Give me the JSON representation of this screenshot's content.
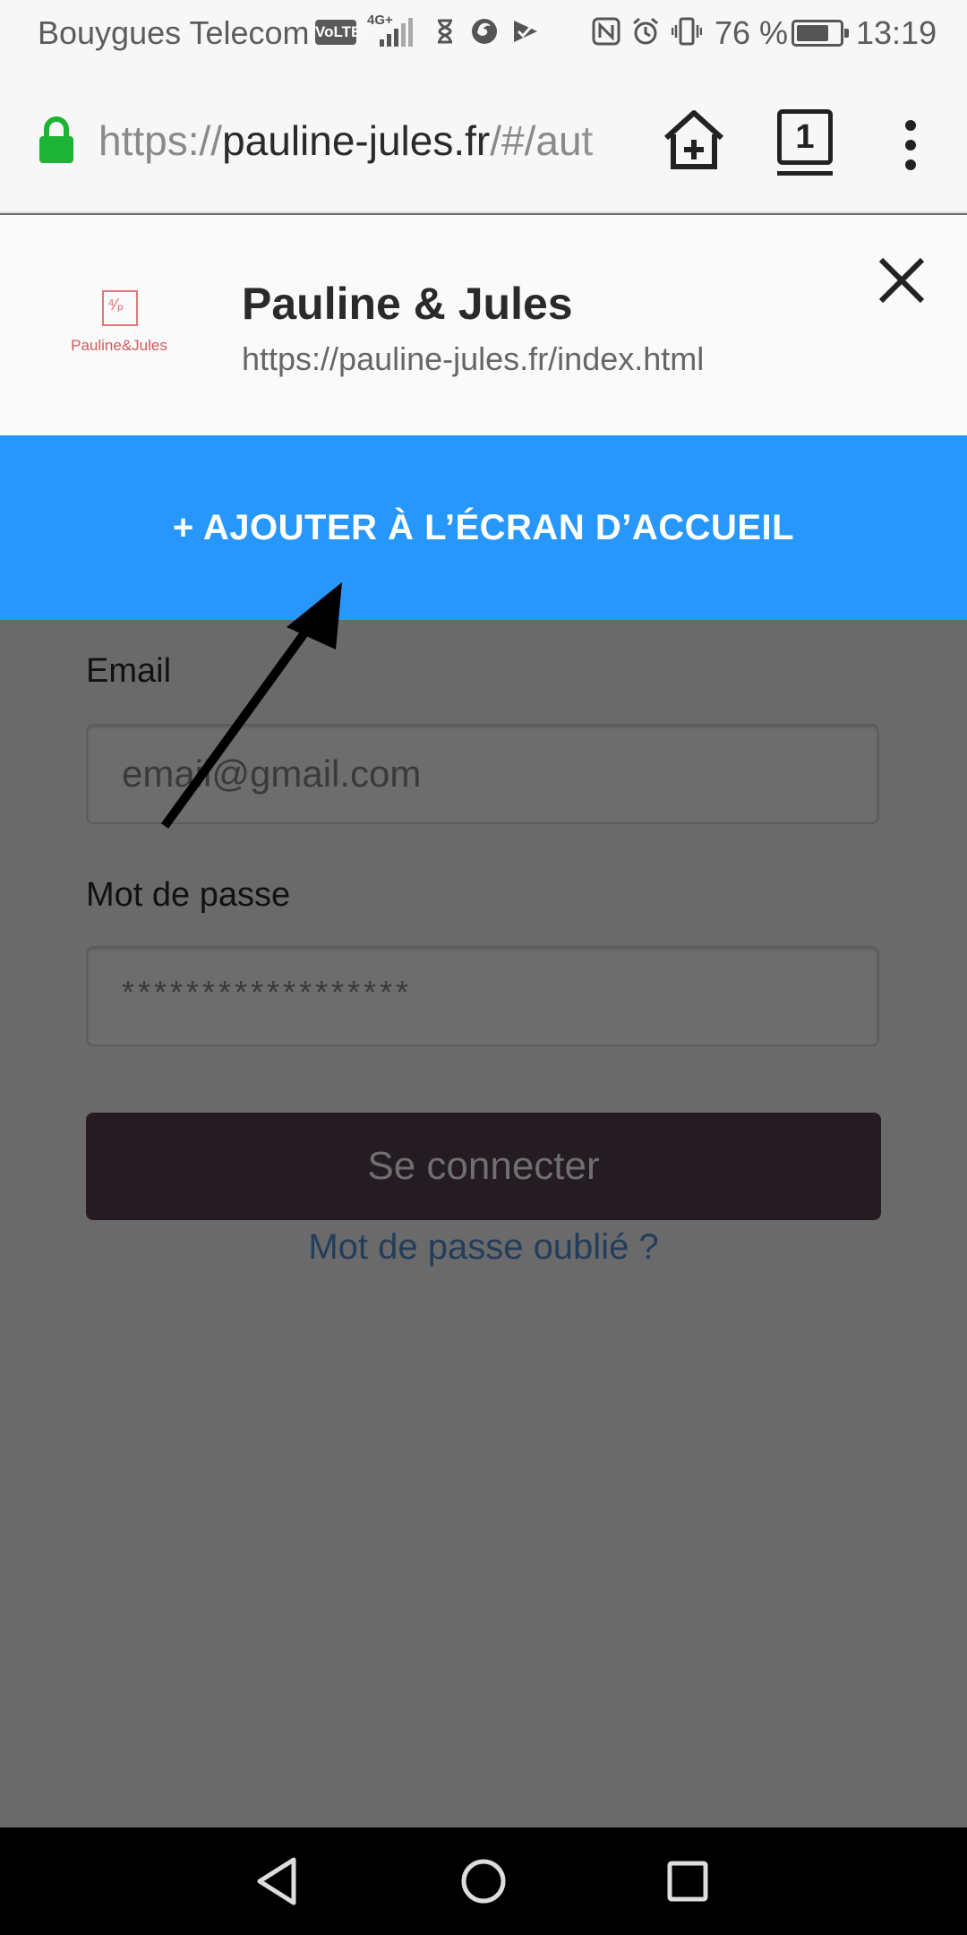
{
  "status_bar": {
    "carrier": "Bouygues Telecom",
    "volte": "VoLTE",
    "network": "4G+",
    "battery_percent": "76 %",
    "battery_level": 0.76,
    "time": "13:19",
    "icons": [
      "volte-icon",
      "signal-icon",
      "hourglass-icon",
      "firefox-icon",
      "check-icon",
      "nfc-icon",
      "alarm-icon",
      "vibrate-icon",
      "battery-icon"
    ]
  },
  "browser": {
    "url_prefix": "https://",
    "url_host": "pauline-jules.fr",
    "url_rest": "/#/aut",
    "tab_count": "1",
    "icons": [
      "lock-icon",
      "add-to-home-icon",
      "tabs-icon",
      "overflow-menu-icon"
    ]
  },
  "install_banner": {
    "logo_text": "Pauline&Jules",
    "app_name": "Pauline & Jules",
    "app_url": "https://pauline-jules.fr/index.html",
    "add_button_label": "+ AJOUTER À L’ÉCRAN D’ACCUEIL",
    "accent_color": "#2797fb"
  },
  "login_form": {
    "email_label": "Email",
    "email_placeholder": "email@gmail.com",
    "password_label": "Mot de passe",
    "password_placeholder": "******************",
    "submit_label": "Se connecter",
    "forgot_link": "Mot de passe oublié ?"
  },
  "nav_bar": {
    "icons": [
      "back-icon",
      "home-icon",
      "recents-icon"
    ]
  }
}
